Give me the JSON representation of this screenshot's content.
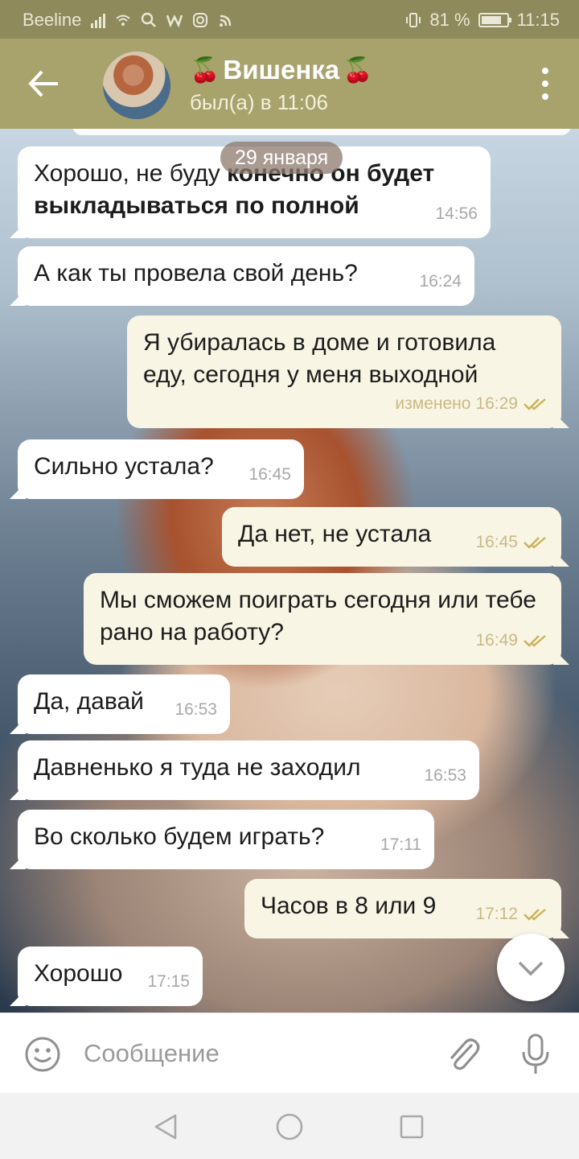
{
  "status_bar": {
    "carrier": "Beeline",
    "battery": "81 %",
    "battery_level": 0.81,
    "time": "11:15",
    "icons": [
      "signal-icon",
      "wifi-icon",
      "search-icon",
      "w-app-icon",
      "instagram-icon",
      "rss-icon",
      "vibrate-icon",
      "battery-icon"
    ]
  },
  "header": {
    "back_icon": "arrow-left-icon",
    "cherry_left": "🍒",
    "name": "Вишенка",
    "cherry_right": "🍒",
    "status": "был(а) в 11:06",
    "menu_icon": "more-vertical-icon"
  },
  "chat": {
    "date_chip": "29 января",
    "messages": [
      {
        "direction": "in",
        "text_normal": "Хорошо, не буду ",
        "text_bold": "конечно он будет выкладываться по полной",
        "time": "14:56"
      },
      {
        "direction": "in",
        "text": "А как ты провела свой день?",
        "time": "16:24"
      },
      {
        "direction": "out",
        "text": "Я убиралась в доме и готовила еду, сегодня у меня выходной",
        "edited": "изменено",
        "time": "16:29",
        "read": true
      },
      {
        "direction": "in",
        "text": "Сильно устала?",
        "time": "16:45"
      },
      {
        "direction": "out",
        "text": "Да нет, не устала",
        "time": "16:45",
        "read": true
      },
      {
        "direction": "out",
        "text": "Мы сможем поиграть сегодня или тебе рано на работу?",
        "time": "16:49",
        "read": true
      },
      {
        "direction": "in",
        "text": "Да, давай",
        "time": "16:53"
      },
      {
        "direction": "in",
        "text": "Давненько я туда не заходил",
        "time": "16:53"
      },
      {
        "direction": "in",
        "text": "Во сколько будем играть?",
        "time": "17:11"
      },
      {
        "direction": "out",
        "text": "Часов в 8 или 9",
        "time": "17:12",
        "read": true
      },
      {
        "direction": "in",
        "text": "Хорошо",
        "time": "17:15"
      }
    ],
    "scroll_down_icon": "chevron-down-icon"
  },
  "composer": {
    "emoji_icon": "smile-icon",
    "placeholder": "Сообщение",
    "value": "",
    "attach_icon": "paperclip-icon",
    "mic_icon": "microphone-icon"
  },
  "navbar": {
    "icons": [
      "back-triangle-icon",
      "home-circle-icon",
      "recents-square-icon"
    ]
  },
  "colors": {
    "header": "#a8a26c",
    "status_bar": "#8e8a5c",
    "bubble_in": "#ffffff",
    "bubble_out": "#f9f5e5",
    "read_check": "#c9b25a"
  }
}
